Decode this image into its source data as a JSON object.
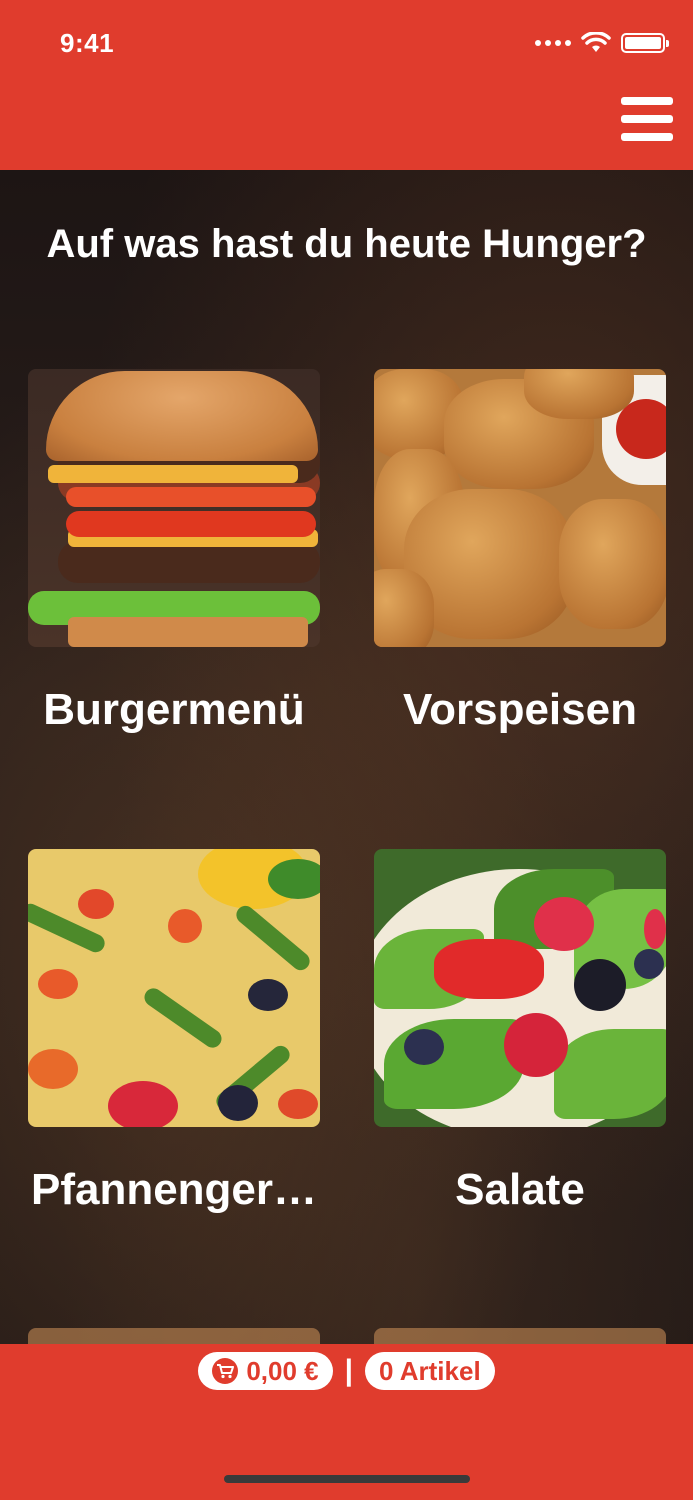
{
  "status_bar": {
    "time": "9:41"
  },
  "header": {
    "menu_icon": "hamburger-menu-icon"
  },
  "main": {
    "title": "Auf was hast du heute Hunger?",
    "categories": [
      {
        "label": "Burgermenü",
        "image": "burger-image"
      },
      {
        "label": "Vorspeisen",
        "image": "nuggets-image"
      },
      {
        "label": "Pfannenger…",
        "image": "paella-image"
      },
      {
        "label": "Salate",
        "image": "salad-image"
      }
    ]
  },
  "footer": {
    "price": "0,00 €",
    "separator": "|",
    "items": "0 Artikel",
    "cart_icon": "shopping-cart-icon"
  },
  "colors": {
    "brand": "#e03c2d",
    "text": "#ffffff"
  }
}
